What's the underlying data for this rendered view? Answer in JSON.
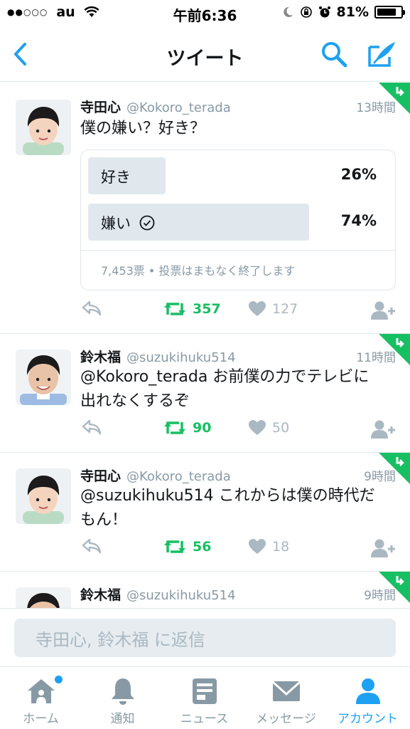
{
  "status_bar": {
    "signal": "●●○○○",
    "carrier": "au",
    "time": "午前6:36",
    "battery_percent": "81%",
    "battery_level": 0.81
  },
  "nav": {
    "title": "ツイート",
    "back_icon": "chevron-left-icon",
    "search_icon": "search-icon",
    "compose_icon": "compose-icon"
  },
  "colors": {
    "accent": "#1da1f2",
    "retweet_green": "#17bf63",
    "muted": "#8899a6",
    "border": "#e1e8ed"
  },
  "tweets": [
    {
      "name": "寺田心",
      "handle": "@Kokoro_terada",
      "time": "13時間",
      "text": "僕の嫌い？好き？",
      "retweets": "357",
      "likes": "127",
      "poll": {
        "options": [
          {
            "label": "好き",
            "percent": "26%",
            "fraction": 0.26,
            "selected": false
          },
          {
            "label": "嫌い",
            "percent": "74%",
            "fraction": 0.74,
            "selected": true
          }
        ],
        "footer": "7,453票 • 投票はまもなく終了します"
      }
    },
    {
      "name": "鈴木福",
      "handle": "@suzukihuku514",
      "time": "11時間",
      "text_lines": [
        "@Kokoro_terada お前僕の力でテレビに",
        "出れなくするぞ"
      ],
      "retweets": "90",
      "likes": "50"
    },
    {
      "name": "寺田心",
      "handle": "@Kokoro_terada",
      "time": "9時間",
      "text_lines": [
        "@suzukihuku514 これからは僕の時代だ",
        "もん！"
      ],
      "retweets": "56",
      "likes": "18"
    },
    {
      "name": "鈴木福",
      "handle": "@suzukihuku514",
      "time": "9時間"
    }
  ],
  "reply": {
    "placeholder": "寺田心, 鈴木福 に返信"
  },
  "tabs": [
    {
      "label": "ホーム",
      "icon": "home-icon",
      "active": false
    },
    {
      "label": "通知",
      "icon": "bell-icon",
      "active": false
    },
    {
      "label": "ニュース",
      "icon": "news-icon",
      "active": false
    },
    {
      "label": "メッセージ",
      "icon": "envelope-icon",
      "active": false
    },
    {
      "label": "アカウント",
      "icon": "person-icon",
      "active": true
    }
  ]
}
